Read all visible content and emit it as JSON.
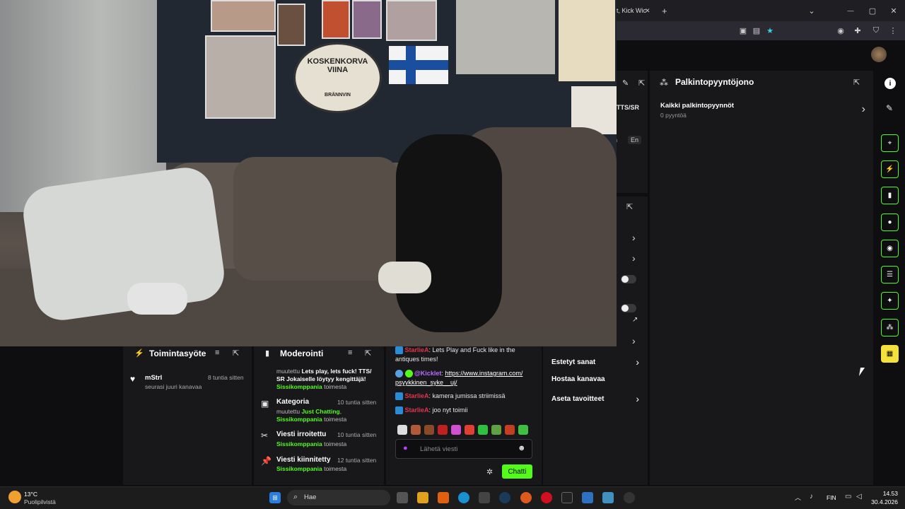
{
  "browser": {
    "tab_title": "t, Kick Wic",
    "tab_close": "✕",
    "new_tab": "+",
    "tab_list": "⌄",
    "win_min": "—",
    "win_max": "▢",
    "win_close": "✕",
    "nav_icons": [
      "pip-icon",
      "extension-icon",
      "star-icon",
      "account-icon",
      "puzzle-icon",
      "shield-icon",
      "menu-icon"
    ]
  },
  "webcam": {
    "sign_line1": "KOSKENKORVA",
    "sign_line2": "VIINA",
    "sign_line3": "BRÄNNVIN"
  },
  "hidden_panel": {
    "edit_icon": "✎",
    "expand_icon": "⇱",
    "label_tts": "TTS/SR",
    "chip_h": "h",
    "chip_en": "En"
  },
  "reward_queue": {
    "title": "Palkintopyyntöjono",
    "item_title": "Kaikki palkintopyynnöt",
    "item_sub": "0 pyyntöä"
  },
  "activity": {
    "title": "Toimintasyöte",
    "user": "mStrl",
    "action": "seurasi juuri kanavaa",
    "time": "8 tuntia sitten"
  },
  "moderation": {
    "title": "Moderointi",
    "items": [
      {
        "title": "",
        "line1a": "muutettu ",
        "line1b": "Lets play, lets fuck! TTS/ SR Jokaiselle löytyy kengittäjä!",
        "actor": "Sissikomppania",
        "suffix": " toimesta",
        "time": ""
      },
      {
        "title": "Kategoria",
        "line1a": "muutettu ",
        "line1b": "Just Chatting",
        "actor": "Sissikomppania",
        "suffix": " toimesta",
        "time": "10 tuntia sitten"
      },
      {
        "title": "Viesti irroitettu",
        "line1a": "",
        "line1b": "",
        "actor": "Sissikomppania",
        "suffix": " toimesta",
        "time": "10 tuntia sitten"
      },
      {
        "title": "Viesti kiinnitetty",
        "line1a": "",
        "line1b": "",
        "actor": "Sissikomppania",
        "suffix": " toimesta",
        "time": "12 tuntia sitten"
      }
    ]
  },
  "chat": {
    "messages": [
      {
        "user": "StarlieA",
        "text": ": Lets Play and Fuck like in the antiques times!"
      },
      {
        "user": "@Kicklet",
        "text": ": ",
        "link": "https://www.instagram.com/ psyykkinen_syke__uj/"
      },
      {
        "user": "StarlieA",
        "text": ": kamera jumissa striimissä"
      },
      {
        "user": "StarlieA",
        "text": ": joo nyt toimii"
      }
    ],
    "input_placeholder": "Lähetä viesti",
    "send_label": "Chatti"
  },
  "settings": {
    "items": [
      "Estetyt sanat",
      "Hostaa kanavaa",
      "Aseta tavoitteet"
    ]
  },
  "taskbar": {
    "weather_temp": "13°C",
    "weather_desc": "Puolipilvistä",
    "search_placeholder": "Hae",
    "lang": "FIN",
    "time": "14.53",
    "date": "30.4.2026"
  },
  "colors": {
    "kick_green": "#53fc18",
    "user_red": "#e0344b",
    "bot_purple": "#b86cff"
  }
}
